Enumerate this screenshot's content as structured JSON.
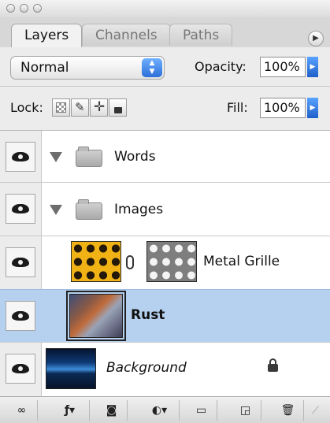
{
  "tabs": [
    {
      "label": "Layers",
      "active": true
    },
    {
      "label": "Channels",
      "active": false
    },
    {
      "label": "Paths",
      "active": false
    }
  ],
  "blend_mode": "Normal",
  "opacity": {
    "label": "Opacity:",
    "value": "100%"
  },
  "lock_label": "Lock:",
  "fill": {
    "label": "Fill:",
    "value": "100%"
  },
  "layers": [
    {
      "name": "Words",
      "type": "group"
    },
    {
      "name": "Images",
      "type": "group"
    },
    {
      "name": "Metal Grille",
      "type": "layer-with-mask"
    },
    {
      "name": "Rust",
      "type": "layer",
      "selected": true
    },
    {
      "name": "Background",
      "type": "background",
      "locked": true
    }
  ],
  "colors": {
    "selection": "#b6d1ef",
    "accent_blue": "#2c6fd8"
  }
}
